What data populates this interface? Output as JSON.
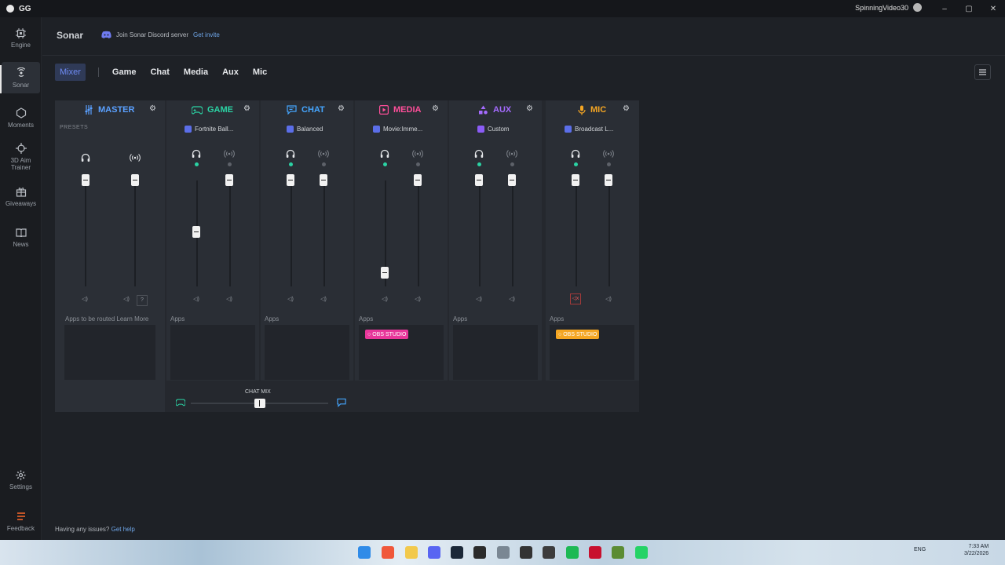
{
  "titlebar": {
    "app_name": "GG",
    "username": "SpinningVideo30",
    "controls": [
      "–",
      "▢",
      "✕"
    ]
  },
  "nav": [
    {
      "label": "Engine",
      "icon": "chip-icon"
    },
    {
      "label": "Sonar",
      "icon": "sonar-icon"
    },
    {
      "label": "Moments",
      "icon": "moments-icon"
    },
    {
      "label": "3D Aim Trainer",
      "icon": "crosshair-icon"
    },
    {
      "label": "Giveaways",
      "icon": "gift-icon"
    },
    {
      "label": "News",
      "icon": "news-icon"
    },
    {
      "label": "Settings",
      "icon": "gear-icon"
    },
    {
      "label": "Feedback",
      "icon": "feedback-icon"
    }
  ],
  "header": {
    "title": "Sonar",
    "discord_text": "Join Sonar Discord server",
    "discord_link": "Get invite"
  },
  "tabs": [
    "Mixer",
    "Game",
    "Chat",
    "Media",
    "Aux",
    "Mic"
  ],
  "menu_icon": "hamburger-icon",
  "master": {
    "label": "MASTER",
    "color": "#5aa0ff",
    "presets_label": "PRESETS",
    "apps_text": "Apps to be routed",
    "apps_link": "Learn More",
    "help_glyph": "?"
  },
  "channels": [
    {
      "key": "game",
      "label": "GAME",
      "color": "#2bd3a4",
      "preset": "Fortnite Ball...",
      "apps_label": "Apps",
      "volume_pct": 48,
      "apps": []
    },
    {
      "key": "chat",
      "label": "CHAT",
      "color": "#45a6ff",
      "preset": "Balanced",
      "apps_label": "Apps",
      "volume_pct": 100,
      "apps": []
    },
    {
      "key": "media",
      "label": "MEDIA",
      "color": "#ff4f9a",
      "preset": "Movie:Imme...",
      "apps_label": "Apps",
      "volume_pct": 7,
      "apps": [
        {
          "name": "OBS STUDIO",
          "color": "#e8369a"
        }
      ]
    },
    {
      "key": "aux",
      "label": "AUX",
      "color": "#a56bff",
      "preset": "Custom",
      "apps_label": "Apps",
      "volume_pct": 100,
      "apps": []
    },
    {
      "key": "mic",
      "label": "MIC",
      "color": "#f5a623",
      "preset": "Broadcast L...",
      "apps_label": "Apps",
      "volume_pct": 100,
      "muted": true,
      "apps": [
        {
          "name": "OBS STUDIO",
          "color": "#f5a623"
        }
      ]
    }
  ],
  "chatmix": {
    "label": "CHAT MIX",
    "balance": 0.5
  },
  "footer": {
    "issue_text": "Having any issues?",
    "issue_link": "Get help"
  },
  "taskbar": {
    "lang": "ENG",
    "time": "7:33 AM",
    "date": "3/22/2026"
  }
}
